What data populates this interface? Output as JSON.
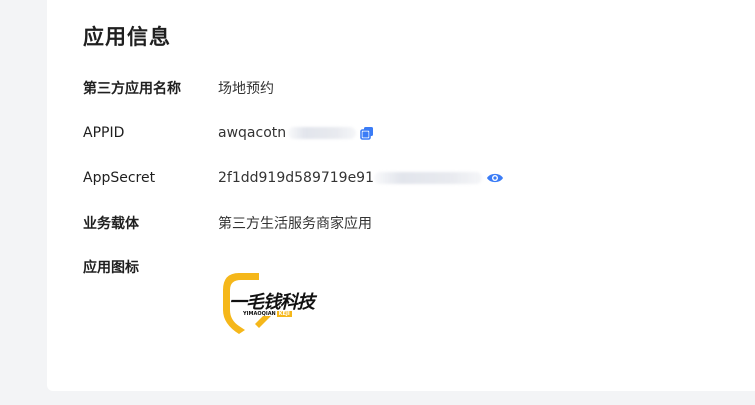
{
  "section": {
    "title": "应用信息"
  },
  "fields": {
    "app_name": {
      "label": "第三方应用名称",
      "value": "场地预约"
    },
    "appid": {
      "label": "APPID",
      "value_prefix": "awqacotn"
    },
    "app_secret": {
      "label": "AppSecret",
      "value_prefix": "2f1dd919d589719e91"
    },
    "carrier": {
      "label": "业务载体",
      "value": "第三方生活服务商家应用"
    },
    "app_icon": {
      "label": "应用图标"
    }
  },
  "logo": {
    "text": "一毛钱科技",
    "subtext": "YIMAOQIAN",
    "subtext_tag": "KEJI"
  },
  "icons": {
    "copy": "copy-icon",
    "eye": "eye-icon"
  },
  "colors": {
    "accent": "#3b7cf6",
    "logo_yellow": "#f5b71a"
  }
}
